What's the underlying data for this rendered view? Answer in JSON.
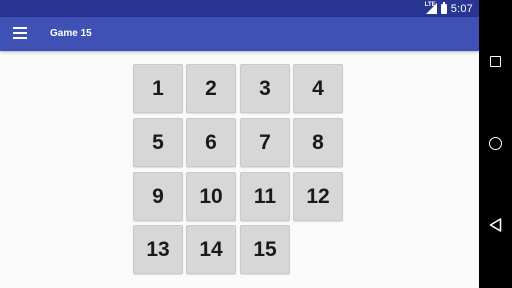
{
  "status_bar": {
    "time": "5:07",
    "network_label": "LTE",
    "icons": [
      "signal-icon",
      "battery-icon"
    ]
  },
  "app_bar": {
    "title": "Game 15",
    "menu_icon": "hamburger-menu-icon"
  },
  "board": {
    "tiles": [
      "1",
      "2",
      "3",
      "4",
      "5",
      "6",
      "7",
      "8",
      "9",
      "10",
      "11",
      "12",
      "13",
      "14",
      "15"
    ],
    "empty_slot": 16
  },
  "nav_bar": {
    "icons": [
      "recents-icon",
      "home-icon",
      "back-icon"
    ]
  },
  "colors": {
    "status_bar": "#283593",
    "app_bar": "#3f51b5",
    "tile": "#d7d7d7",
    "background": "#fafafa"
  }
}
